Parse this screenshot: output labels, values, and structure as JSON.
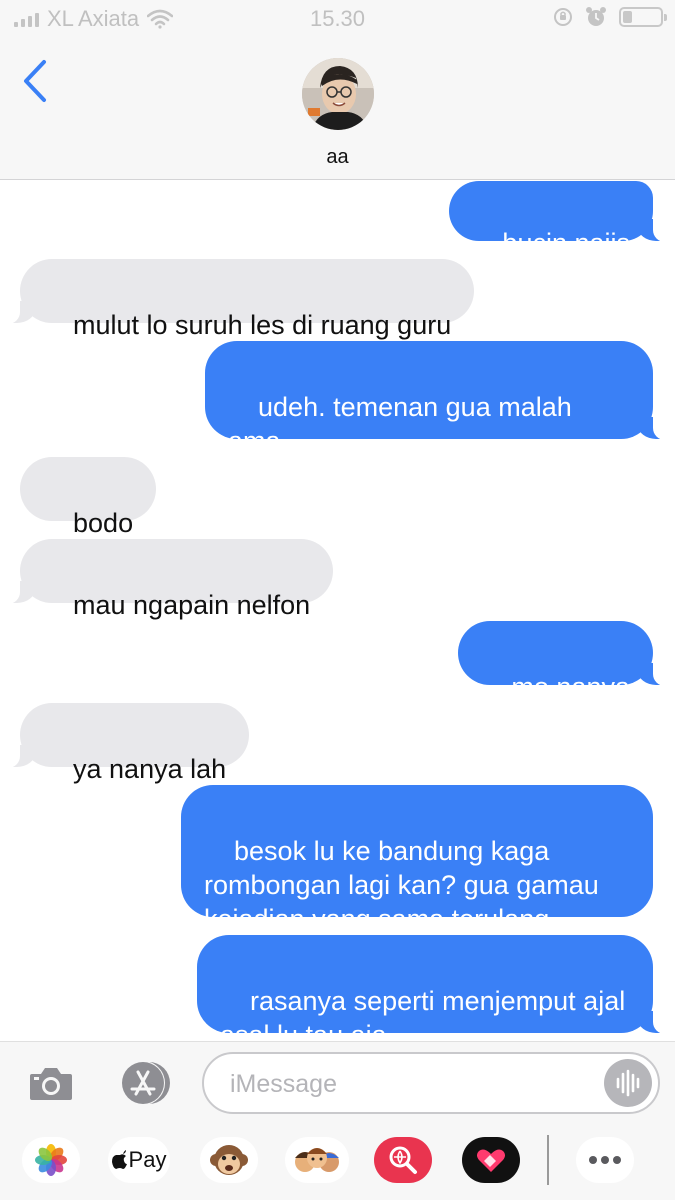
{
  "status_bar": {
    "carrier": "XL Axiata",
    "time": "15.30",
    "battery_level": 0.25
  },
  "header": {
    "contact_name": "aa",
    "back_icon": "chevron-left-icon"
  },
  "messages": [
    {
      "direction": "out",
      "text": "bucin najis"
    },
    {
      "direction": "in",
      "text": "mulut lo suruh les di ruang guru"
    },
    {
      "direction": "out",
      "text": "udeh. temenan gua malah ama\nsi iqbal"
    },
    {
      "direction": "in",
      "text": "bodo"
    },
    {
      "direction": "in",
      "text": "mau ngapain nelfon"
    },
    {
      "direction": "out",
      "text": "mo nanya"
    },
    {
      "direction": "in",
      "text": "ya nanya lah"
    },
    {
      "direction": "out",
      "text": "besok lu ke bandung kaga\nrombongan lagi kan? gua gamau\nkejadian yang sama terulang"
    },
    {
      "direction": "out",
      "text": "rasanya seperti menjemput ajal\nasal lu tau aja"
    }
  ],
  "input_bar": {
    "placeholder": "iMessage",
    "value": ""
  },
  "app_drawer": {
    "apple_pay_label": "Pay",
    "apps": [
      "photos-icon",
      "apple-pay-icon",
      "animoji-icon",
      "memoji-stickers-icon",
      "web-images-search-icon",
      "digital-touch-icon",
      "more-apps-icon"
    ]
  },
  "colors": {
    "outgoing_bubble": "#3a80f6",
    "incoming_bubble": "#e8e8eb",
    "accent": "#3a80f6"
  }
}
